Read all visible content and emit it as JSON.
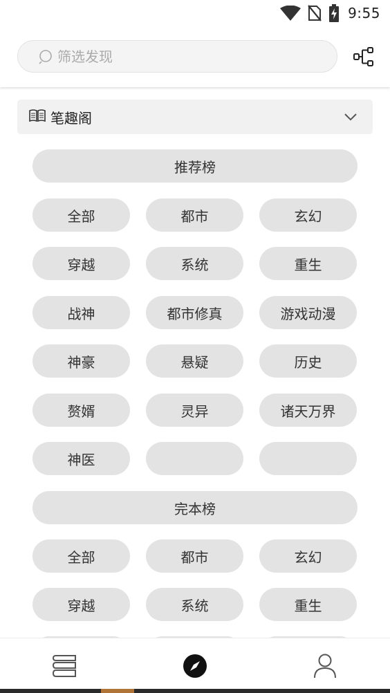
{
  "status_bar": {
    "time": "9:55",
    "icons": [
      "wifi-icon",
      "no-sim-icon",
      "battery-charging-icon"
    ]
  },
  "search": {
    "placeholder": "筛选发现",
    "value": ""
  },
  "source": {
    "label": "笔趣阁",
    "icon": "book-open-icon"
  },
  "sections": [
    {
      "title": "推荐榜",
      "tags": [
        "全部",
        "都市",
        "玄幻",
        "穿越",
        "系统",
        "重生",
        "战神",
        "都市修真",
        "游戏动漫",
        "神豪",
        "悬疑",
        "历史",
        "赘婿",
        "灵异",
        "诸天万界",
        "神医",
        "",
        ""
      ]
    },
    {
      "title": "完本榜",
      "tags": [
        "全部",
        "都市",
        "玄幻",
        "穿越",
        "系统",
        "重生"
      ]
    }
  ],
  "bottom_nav": {
    "items": [
      {
        "icon": "bookshelf-icon",
        "active": false
      },
      {
        "icon": "compass-icon",
        "active": true
      },
      {
        "icon": "profile-icon",
        "active": false
      }
    ]
  },
  "colors": {
    "pill_bg": "#e3e3e3",
    "search_bg": "#f4f4f4",
    "home_indicator_accent": "#b07438"
  }
}
